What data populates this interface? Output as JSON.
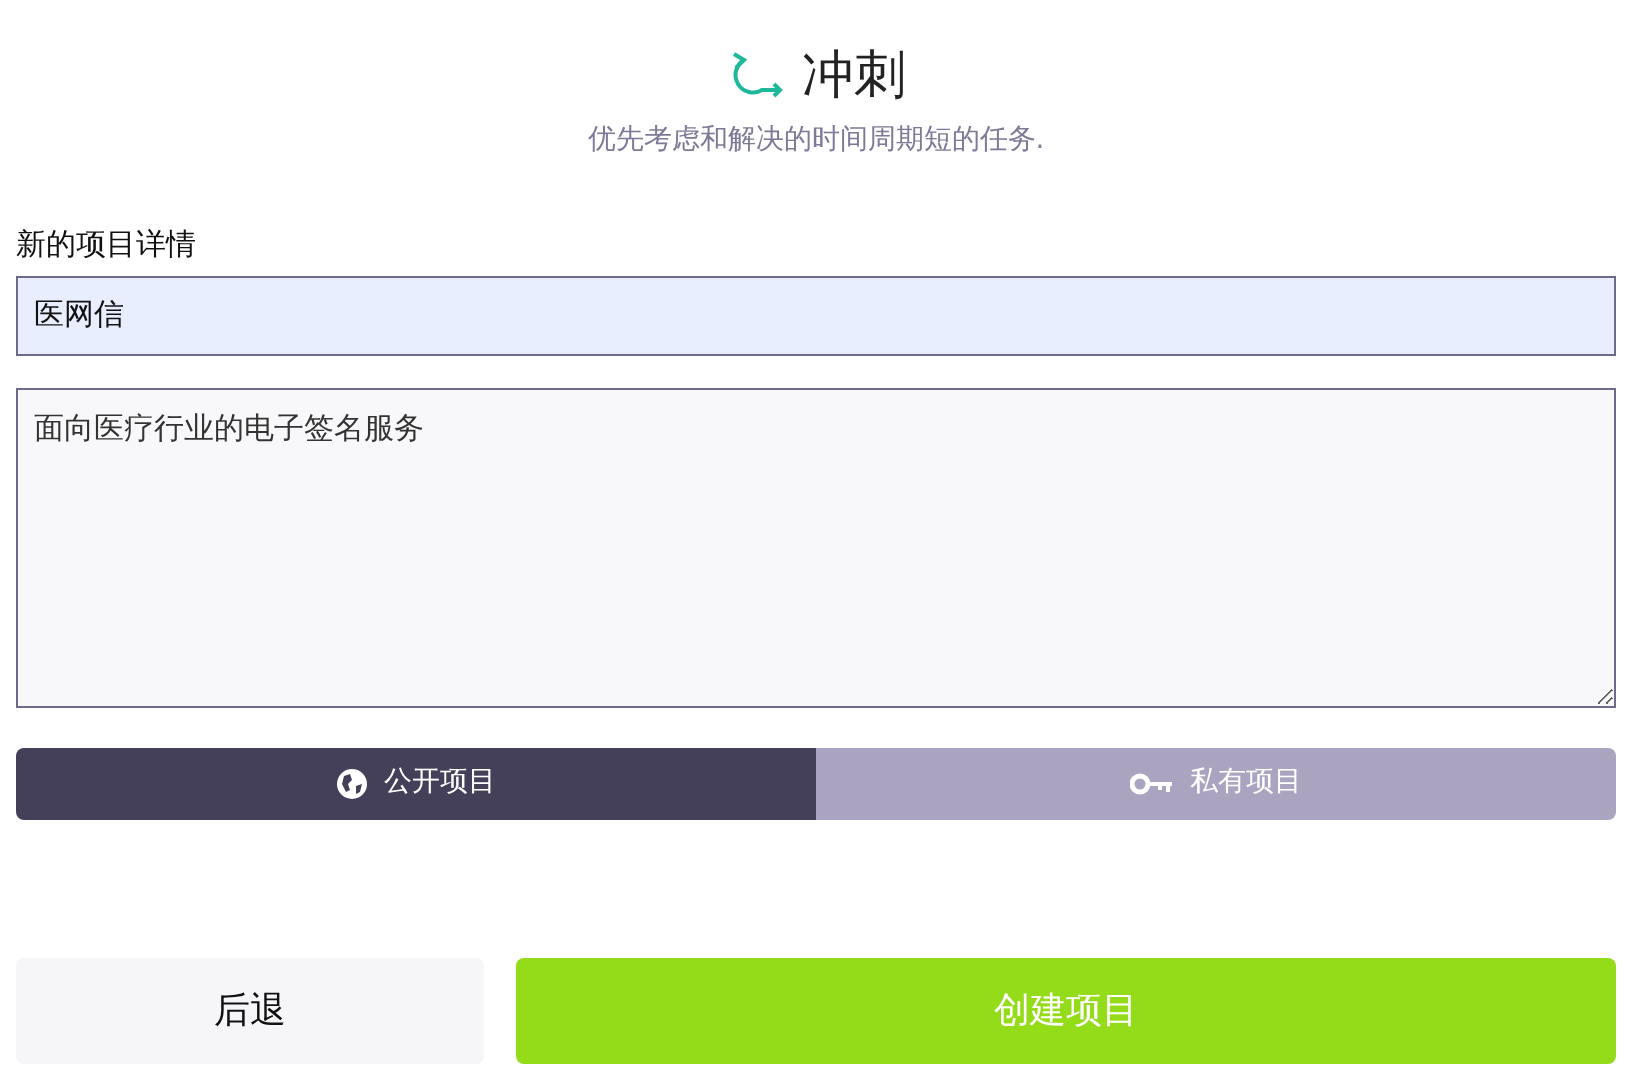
{
  "header": {
    "title": "冲刺",
    "subtitle": "优先考虑和解决的时间周期短的任务."
  },
  "form": {
    "label": "新的项目详情",
    "name_value": "医网信",
    "description_value": "面向医疗行业的电子签名服务"
  },
  "visibility": [
    {
      "kind": "public",
      "label": "公开项目",
      "selected": true
    },
    {
      "kind": "private",
      "label": "私有项目",
      "selected": false
    }
  ],
  "buttons": {
    "back": "后退",
    "create": "创建项目"
  }
}
